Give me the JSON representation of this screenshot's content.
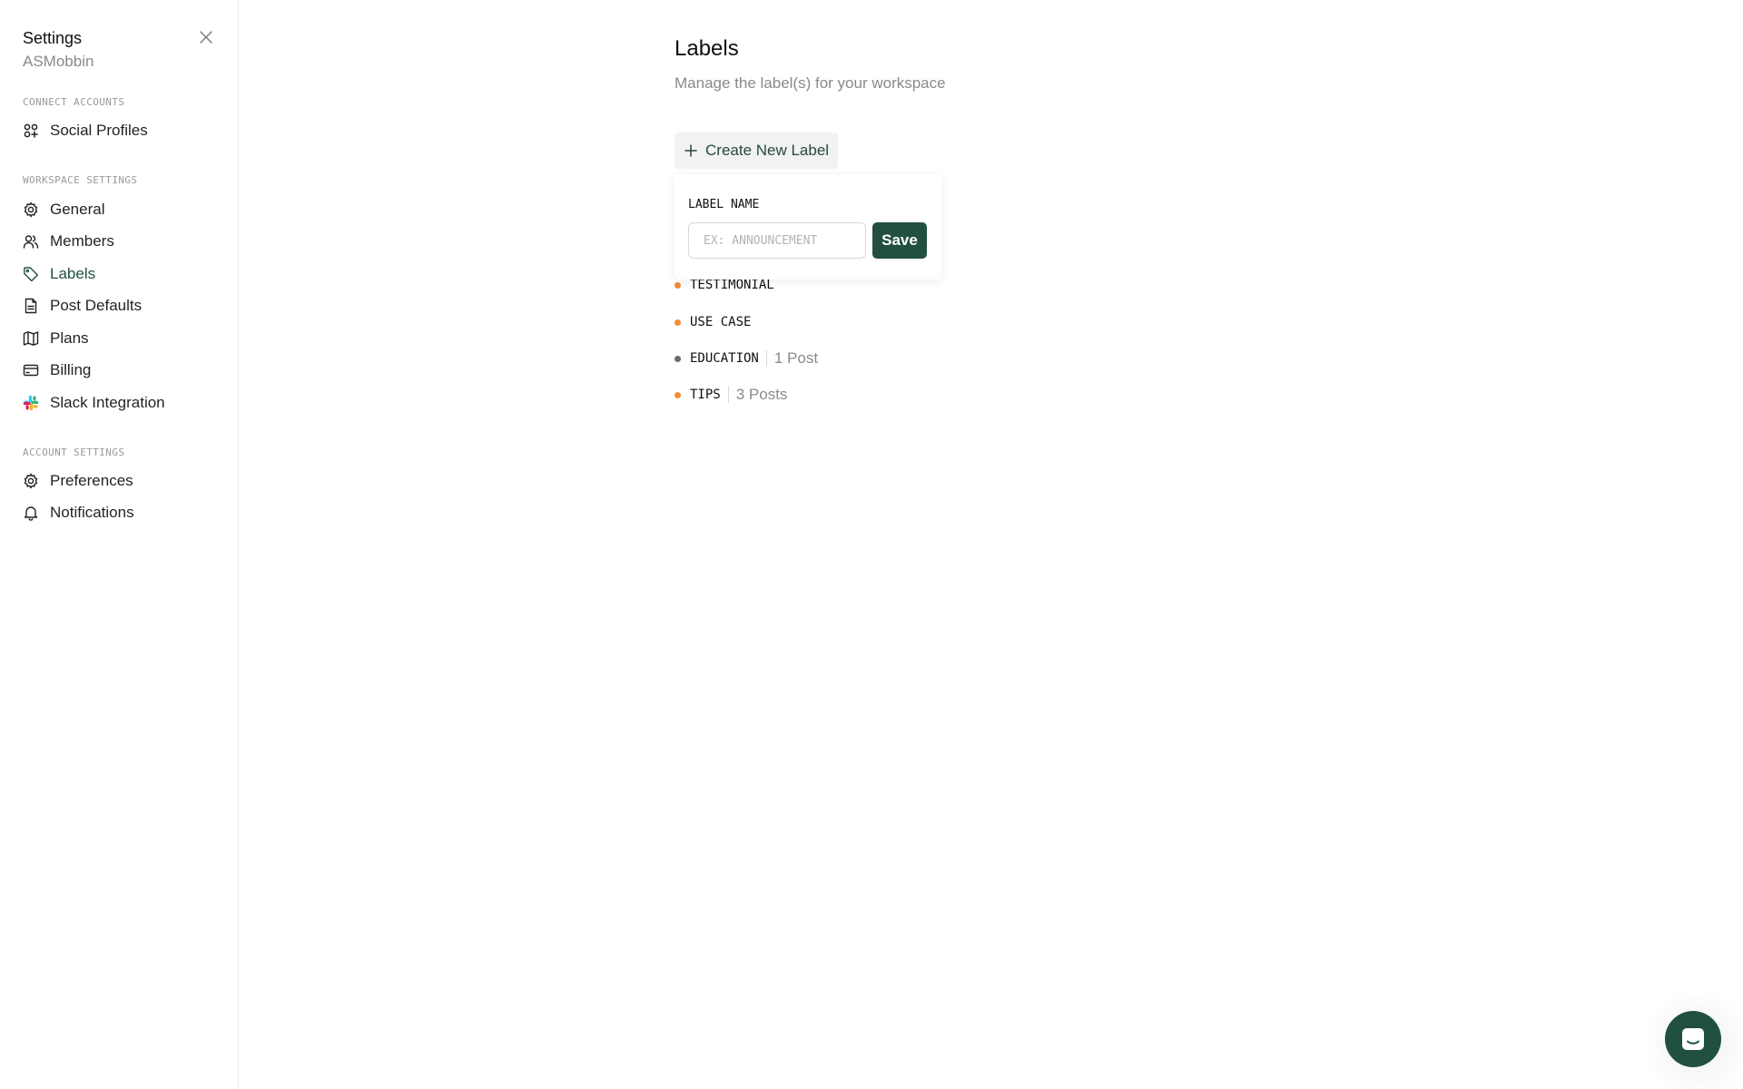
{
  "sidebar": {
    "title": "Settings",
    "workspace": "ASMobbin",
    "sections": [
      {
        "label": "CONNECT ACCOUNTS",
        "items": [
          {
            "label": "Social Profiles",
            "icon": "social-profiles-icon"
          }
        ]
      },
      {
        "label": "WORKSPACE SETTINGS",
        "items": [
          {
            "label": "General",
            "icon": "gear-icon"
          },
          {
            "label": "Members",
            "icon": "members-icon"
          },
          {
            "label": "Labels",
            "icon": "tag-icon",
            "active": true
          },
          {
            "label": "Post Defaults",
            "icon": "document-icon"
          },
          {
            "label": "Plans",
            "icon": "map-icon"
          },
          {
            "label": "Billing",
            "icon": "credit-card-icon"
          },
          {
            "label": "Slack Integration",
            "icon": "slack-icon"
          }
        ]
      },
      {
        "label": "ACCOUNT SETTINGS",
        "items": [
          {
            "label": "Preferences",
            "icon": "gear-icon"
          },
          {
            "label": "Notifications",
            "icon": "bell-icon"
          }
        ]
      }
    ]
  },
  "main": {
    "title": "Labels",
    "subtitle": "Manage the label(s) for your workspace",
    "create_button": "Create New Label",
    "popover": {
      "label": "LABEL NAME",
      "placeholder": "EX: ANNOUNCEMENT",
      "value": "",
      "save_label": "Save"
    },
    "labels": [
      {
        "name": "TESTIMONIAL",
        "count": "",
        "color": "#f28c38"
      },
      {
        "name": "USE CASE",
        "count": "",
        "color": "#f28c38"
      },
      {
        "name": "EDUCATION",
        "count": "1 Post",
        "color": "#6b6b6b"
      },
      {
        "name": "TIPS",
        "count": "3 Posts",
        "color": "#f28c38"
      }
    ]
  },
  "colors": {
    "accent": "#21503f",
    "muted_text": "#8a8a8a",
    "orange_dot": "#f28c38",
    "gray_dot": "#6b6b6b"
  },
  "chat_widget": {
    "icon": "chat-icon"
  }
}
